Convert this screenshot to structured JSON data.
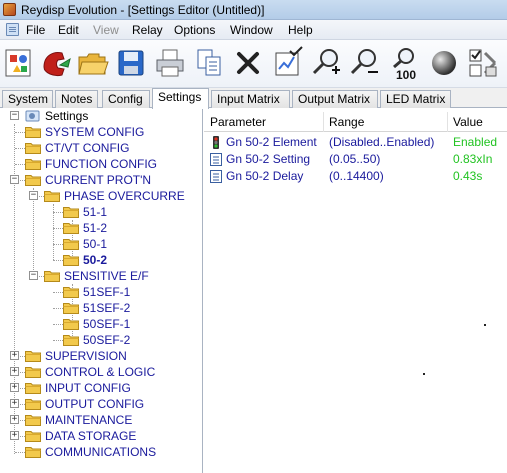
{
  "window": {
    "title": "Reydisp Evolution - [Settings Editor (Untitled)]"
  },
  "menu": {
    "items": [
      {
        "label": "File",
        "enabled": true
      },
      {
        "label": "Edit",
        "enabled": true
      },
      {
        "label": "View",
        "enabled": false
      },
      {
        "label": "Relay",
        "enabled": true
      },
      {
        "label": "Options",
        "enabled": true
      },
      {
        "label": "Window",
        "enabled": true
      },
      {
        "label": "Help",
        "enabled": true
      }
    ]
  },
  "toolbar": {
    "buttons": [
      {
        "icon": "shapes-icon"
      },
      {
        "icon": "phone-connect-icon"
      },
      {
        "icon": "open-folder-icon"
      },
      {
        "icon": "save-disk-icon"
      },
      {
        "icon": "printer-icon"
      },
      {
        "icon": "copy-icon"
      },
      {
        "icon": "delete-x-icon"
      },
      {
        "icon": "chart-check-icon"
      },
      {
        "icon": "zoom-in-icon"
      },
      {
        "icon": "zoom-out-icon"
      },
      {
        "icon": "zoom-100-icon",
        "text": "100"
      },
      {
        "icon": "sphere-icon"
      },
      {
        "icon": "checklist-icon"
      }
    ]
  },
  "tabs": [
    {
      "label": "System",
      "active": false
    },
    {
      "label": "Notes",
      "active": false
    },
    {
      "label": "Config",
      "active": false
    },
    {
      "label": "Settings",
      "active": true
    },
    {
      "label": "Input Matrix",
      "active": false
    },
    {
      "label": "Output Matrix",
      "active": false
    },
    {
      "label": "LED Matrix",
      "active": false
    }
  ],
  "tree": {
    "root": "Settings",
    "nodes": [
      {
        "label": "SYSTEM CONFIG"
      },
      {
        "label": "CT/VT CONFIG"
      },
      {
        "label": "FUNCTION CONFIG"
      },
      {
        "label": "CURRENT PROT'N",
        "expanded": true
      },
      {
        "label": "PHASE OVERCURRE",
        "expanded": true
      },
      {
        "label": "51-1"
      },
      {
        "label": "51-2"
      },
      {
        "label": "50-1"
      },
      {
        "label": "50-2",
        "selected": true
      },
      {
        "label": "SENSITIVE E/F",
        "expanded": true
      },
      {
        "label": "51SEF-1"
      },
      {
        "label": "51SEF-2"
      },
      {
        "label": "50SEF-1"
      },
      {
        "label": "50SEF-2"
      },
      {
        "label": "SUPERVISION"
      },
      {
        "label": "CONTROL & LOGIC"
      },
      {
        "label": "INPUT CONFIG"
      },
      {
        "label": "OUTPUT CONFIG"
      },
      {
        "label": "MAINTENANCE"
      },
      {
        "label": "DATA STORAGE"
      },
      {
        "label": "COMMUNICATIONS"
      }
    ]
  },
  "grid": {
    "columns": [
      "Parameter",
      "Range",
      "Value"
    ],
    "rows": [
      {
        "icon": "traffic-light-icon",
        "parameter": "Gn 50-2 Element",
        "range": "(Disabled..Enabled)",
        "value": "Enabled"
      },
      {
        "icon": "list-icon",
        "parameter": "Gn 50-2 Setting",
        "range": "(0.05..50)",
        "value": "0.83xIn"
      },
      {
        "icon": "list-icon",
        "parameter": "Gn 50-2 Delay",
        "range": "(0..14400)",
        "value": "0.43s"
      }
    ]
  },
  "colors": {
    "tree_text": "#1a1a9c",
    "value_text": "#22c322",
    "folder": "#f2c94c"
  }
}
